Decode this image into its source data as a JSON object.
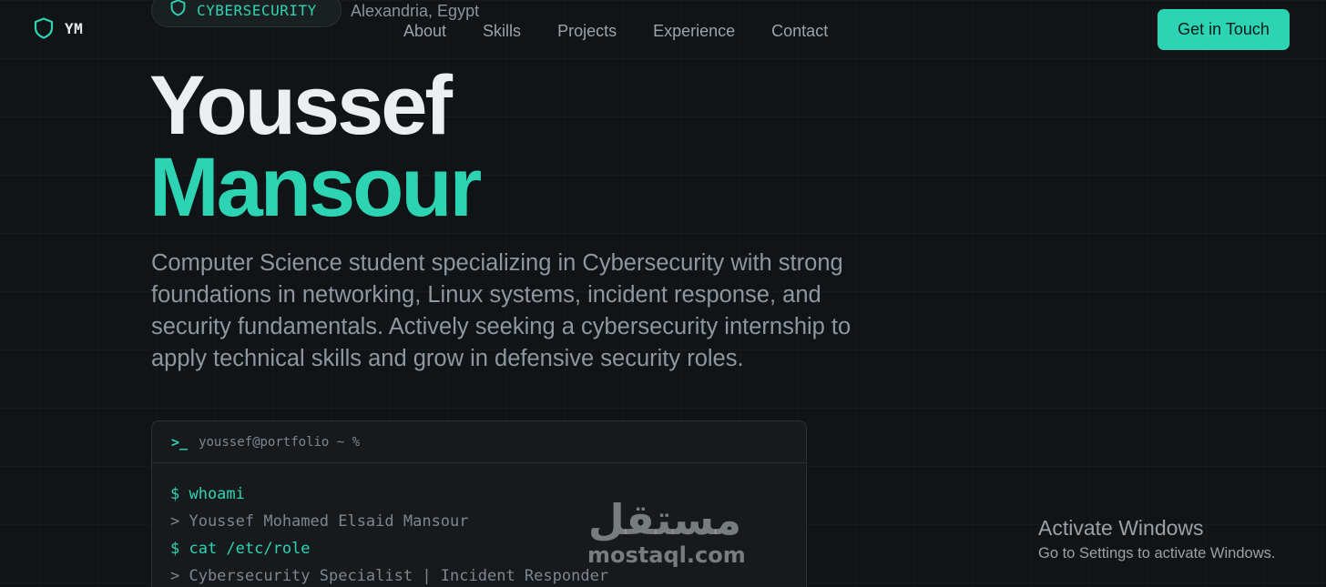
{
  "nav": {
    "logo_text": "YM",
    "links": [
      "About",
      "Skills",
      "Projects",
      "Experience",
      "Contact"
    ],
    "cta_label": "Get in Touch"
  },
  "hero": {
    "badge": "CYBERSECURITY",
    "location": "Alexandria, Egypt",
    "first_name": "Youssef",
    "last_name": "Mansour",
    "description": "Computer Science student specializing in Cybersecurity with strong foundations in networking, Linux systems, incident response, and security fundamentals. Actively seeking a cybersecurity internship to apply technical skills and grow in defensive security roles."
  },
  "terminal": {
    "prompt_icon": ">_",
    "title": "youssef@portfolio ~ %",
    "lines": [
      {
        "type": "command",
        "text": "$ whoami"
      },
      {
        "type": "output",
        "text": "> Youssef Mohamed Elsaid Mansour"
      },
      {
        "type": "command",
        "text": "$ cat /etc/role"
      },
      {
        "type": "output",
        "text": "> Cybersecurity Specialist | Incident Responder"
      }
    ]
  },
  "watermark": {
    "arabic": "مستقل",
    "latin": "mostaql.com"
  },
  "os_notice": {
    "title": "Activate Windows",
    "subtitle": "Go to Settings to activate Windows."
  },
  "colors": {
    "accent": "#2dd4b3",
    "background": "#111416",
    "text_primary": "#eceeef",
    "text_muted": "#8e979f"
  }
}
